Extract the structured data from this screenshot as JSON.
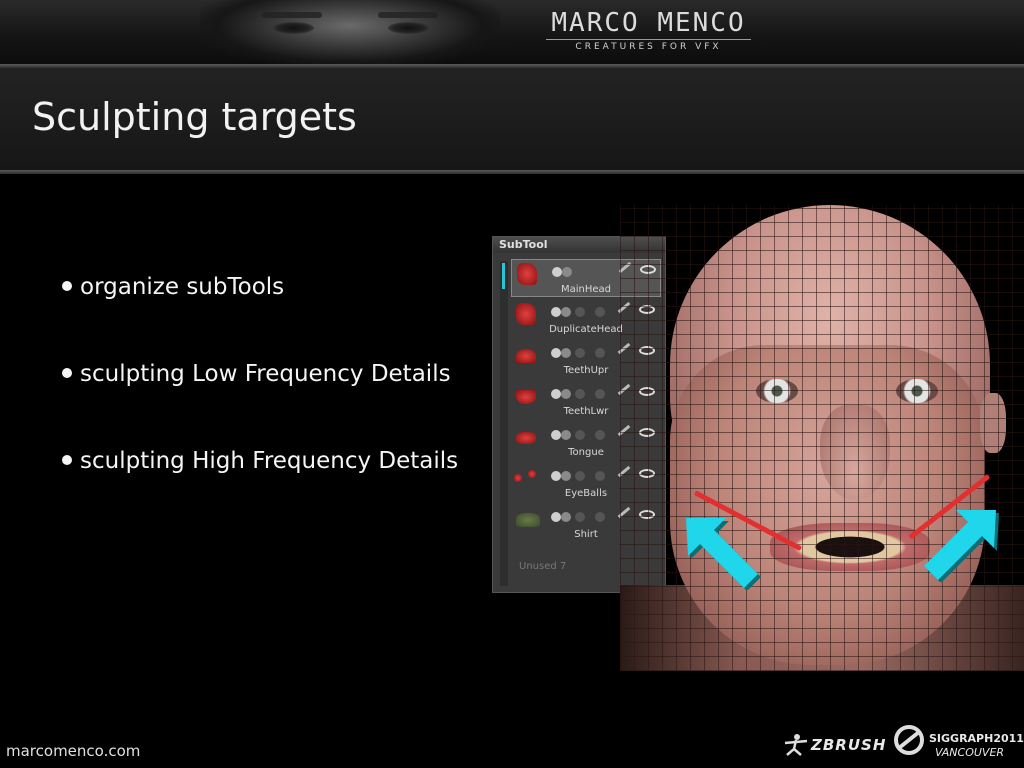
{
  "header": {
    "brand_name": "MARCO MENCO",
    "brand_tagline": "Creatures for VFX"
  },
  "slide": {
    "title": "Sculpting targets",
    "bullets": [
      "organize subTools",
      "sculpting Low Frequency Details",
      "sculpting High Frequency Details"
    ]
  },
  "subtool_panel": {
    "title": "SubTool",
    "items": [
      {
        "label": "MainHead",
        "active": true
      },
      {
        "label": "DuplicateHead",
        "active": false
      },
      {
        "label": "TeethUpr",
        "active": false
      },
      {
        "label": "TeethLwr",
        "active": false
      },
      {
        "label": "Tongue",
        "active": false
      },
      {
        "label": "EyeBalls",
        "active": false
      },
      {
        "label": "Shirt",
        "active": false
      }
    ],
    "unused_label": "Unused 7"
  },
  "colors": {
    "accent_cyan": "#29c5d6",
    "arrow_cyan": "#1fd6ea",
    "target_line_red": "#e23030"
  },
  "footer": {
    "website": "marcomenco.com",
    "logo_zbrush": "ZBRUSH",
    "logo_siggraph": "SIGGRAPH2011",
    "logo_siggraph_city": "VANCOUVER"
  }
}
